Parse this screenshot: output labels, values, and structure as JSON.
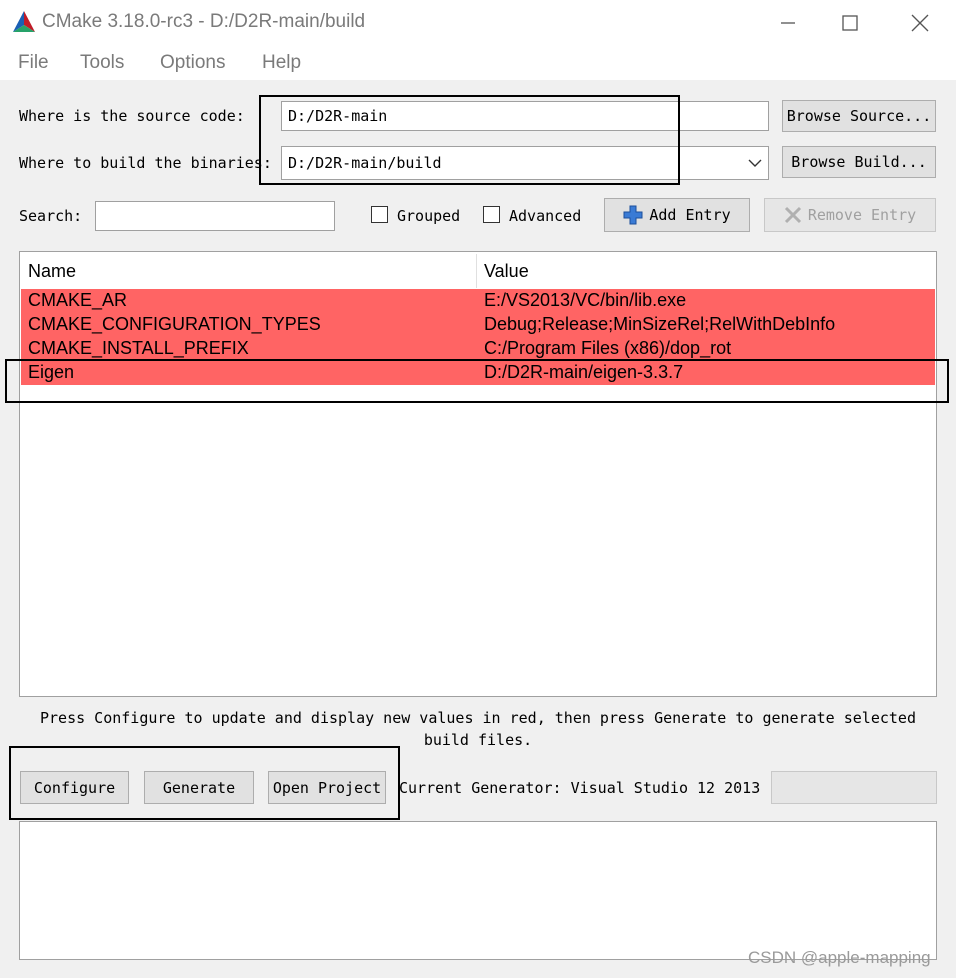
{
  "window": {
    "title": "CMake 3.18.0-rc3 - D:/D2R-main/build",
    "icons": {
      "logo": "cmake-triangle-logo",
      "minimize": "minimize-icon",
      "maximize": "maximize-icon",
      "close": "close-icon"
    }
  },
  "menu": {
    "items": [
      "File",
      "Tools",
      "Options",
      "Help"
    ]
  },
  "source": {
    "label": "Where is the source code:",
    "value": "D:/D2R-main",
    "browse_label": "Browse Source..."
  },
  "build": {
    "label": "Where to build the binaries:",
    "value": "D:/D2R-main/build",
    "browse_label": "Browse Build..."
  },
  "search": {
    "label": "Search:",
    "value": ""
  },
  "options": {
    "grouped_label": "Grouped",
    "grouped_checked": false,
    "advanced_label": "Advanced",
    "advanced_checked": false
  },
  "entries": {
    "add_label": "Add Entry",
    "remove_label": "Remove Entry"
  },
  "table": {
    "headers": {
      "name": "Name",
      "value": "Value"
    },
    "row_color": "#ff6464",
    "rows": [
      {
        "name": "CMAKE_AR",
        "value": "E:/VS2013/VC/bin/lib.exe"
      },
      {
        "name": "CMAKE_CONFIGURATION_TYPES",
        "value": "Debug;Release;MinSizeRel;RelWithDebInfo"
      },
      {
        "name": "CMAKE_INSTALL_PREFIX",
        "value": "C:/Program Files (x86)/dop_rot"
      },
      {
        "name": "Eigen",
        "value": "D:/D2R-main/eigen-3.3.7"
      }
    ]
  },
  "hint": {
    "line1": "Press Configure to update and display new values in red, then press Generate to generate selected",
    "line2": "build files."
  },
  "actions": {
    "configure_label": "Configure",
    "generate_label": "Generate",
    "open_project_label": "Open Project"
  },
  "generator": {
    "label": "Current Generator: Visual Studio 12 2013"
  },
  "output": {
    "text": ""
  },
  "watermark": "CSDN @apple-mapping"
}
